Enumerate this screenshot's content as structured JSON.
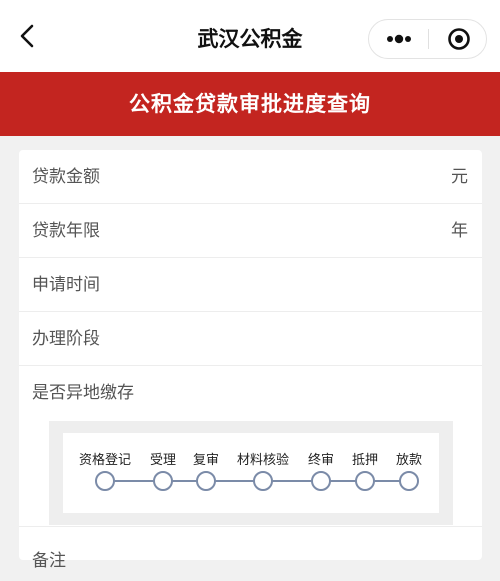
{
  "nav": {
    "title": "武汉公积金",
    "back_icon": "chevron-left-icon",
    "more_icon": "more-dots-icon",
    "close_icon": "target-close-icon"
  },
  "banner": {
    "title": "公积金贷款审批进度查询",
    "color": "#c32520"
  },
  "fields": [
    {
      "label": "贷款金额",
      "unit": "元",
      "value": ""
    },
    {
      "label": "贷款年限",
      "unit": "年",
      "value": ""
    },
    {
      "label": "申请时间",
      "unit": "",
      "value": ""
    },
    {
      "label": "办理阶段",
      "unit": "",
      "value": ""
    },
    {
      "label": "是否异地缴存",
      "unit": "",
      "value": ""
    }
  ],
  "progress": {
    "steps": [
      {
        "label": "资格登记"
      },
      {
        "label": "受理"
      },
      {
        "label": "复审"
      },
      {
        "label": "材料核验"
      },
      {
        "label": "终审"
      },
      {
        "label": "抵押"
      },
      {
        "label": "放款"
      }
    ],
    "node_color": "#7b8ba8"
  },
  "cut_row": {
    "label": "备注"
  }
}
